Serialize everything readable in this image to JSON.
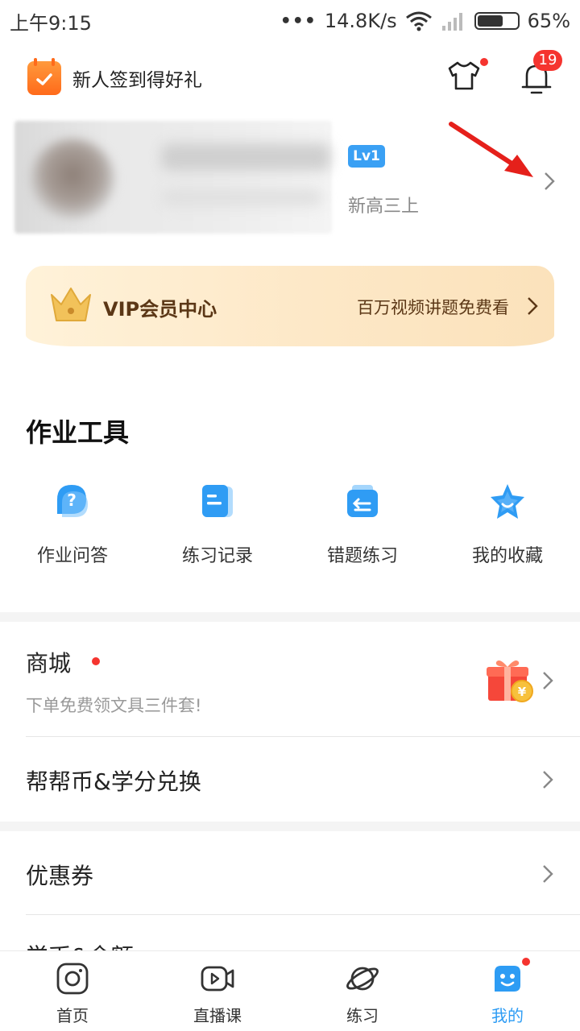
{
  "status_bar": {
    "time": "上午9:15",
    "network_speed": "14.8K/s",
    "battery": "65%",
    "battery_level": 0.65
  },
  "header": {
    "checkin_label": "新人签到得好礼",
    "notification_count": "19"
  },
  "profile": {
    "level": "Lv1",
    "grade": "新高三上"
  },
  "vip": {
    "title": "VIP会员中心",
    "description": "百万视频讲题免费看"
  },
  "tools": {
    "title": "作业工具",
    "items": [
      {
        "label": "作业问答",
        "icon": "question-bubble-icon"
      },
      {
        "label": "练习记录",
        "icon": "record-doc-icon"
      },
      {
        "label": "错题练习",
        "icon": "wrong-question-icon"
      },
      {
        "label": "我的收藏",
        "icon": "star-favorite-icon"
      }
    ]
  },
  "menu": {
    "shop_title": "商城",
    "shop_subtitle": "下单免费领文具三件套!",
    "coins_title": "帮帮币&学分兑换",
    "coupon_title": "优惠券",
    "partial_title": "学币&余额"
  },
  "bottom_nav": {
    "items": [
      {
        "label": "首页",
        "icon": "home-camera-icon"
      },
      {
        "label": "直播课",
        "icon": "live-video-icon"
      },
      {
        "label": "练习",
        "icon": "planet-icon"
      },
      {
        "label": "我的",
        "icon": "mine-face-icon"
      }
    ],
    "active_index": 3
  },
  "colors": {
    "accent": "#2d9cf4",
    "badge_red": "#f5342f",
    "vip_text": "#5b3716"
  }
}
